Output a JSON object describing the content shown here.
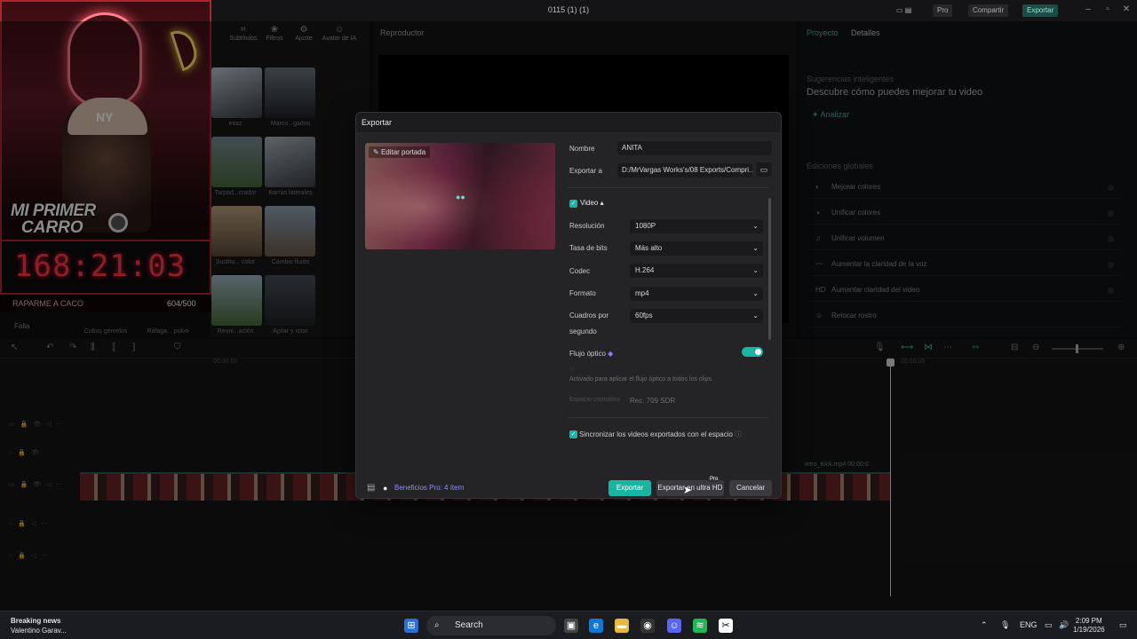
{
  "window": {
    "title": "0115 (1) (1)",
    "pro_label": "Pro",
    "share_label": "Compartir",
    "export_label": "Exportar"
  },
  "media_panel": {
    "tabs": [
      {
        "label": "Subtítulos",
        "icon": "captions-icon"
      },
      {
        "label": "Filtros",
        "icon": "filters-icon"
      },
      {
        "label": "Ajuste",
        "icon": "adjust-icon"
      },
      {
        "label": "Avatar de IA",
        "icon": "ai-avatar-icon"
      }
    ],
    "items": [
      "intaz",
      "Marco...gados",
      "Tarpad...crador",
      "Barras laterales",
      "Sustitu... color",
      "Cambio fluido",
      "Cubos gemelos",
      "Ráfaga... polvo",
      "Reuni...ación",
      "Apilar y rotar"
    ]
  },
  "player": {
    "title": "Reproductor"
  },
  "properties": {
    "tabs": [
      "Proyecto",
      "Detalles"
    ],
    "suggestions_label": "Sugerencias inteligentes",
    "suggestions_text": "Descubre cómo puedes mejorar tu video",
    "analyze_label": "Analizar",
    "global_title": "Ediciones globales",
    "global_items": [
      {
        "label": "Mejorar colores",
        "icon": "color-icon"
      },
      {
        "label": "Unificar colores",
        "icon": "palette-icon"
      },
      {
        "label": "Unificar volumen",
        "icon": "volume-icon"
      },
      {
        "label": "Aumentar la claridad de la voz",
        "icon": "voice-icon"
      },
      {
        "label": "Aumentar claridad del video",
        "icon": "hd-icon"
      },
      {
        "label": "Retocar rostro",
        "icon": "face-icon"
      }
    ]
  },
  "webcam": {
    "title_line1": "MI PRIMER",
    "title_line2": "CARRO",
    "countdown": "168:21:03",
    "goal_label": "RAPARME A CACO",
    "goal_count": "604/500",
    "status": "Falla"
  },
  "timeline": {
    "clip_name": "intro_Kick.mp4",
    "clip_time": "00:00:0",
    "timecodes": [
      "00:00:00",
      "00:00:05"
    ]
  },
  "export_dialog": {
    "title": "Exportar",
    "edit_cover": "Editar portada",
    "name_label": "Nombre",
    "name_value": "ANITA",
    "export_to_label": "Exportar a",
    "export_to_value": "D:/MrVargas Works's/08 Exports/Compri...",
    "video_section": "Video",
    "resolution_label": "Resolución",
    "resolution_value": "1080P",
    "bitrate_label": "Tasa de bits",
    "bitrate_value": "Más alto",
    "codec_label": "Codec",
    "codec_value": "H.264",
    "format_label": "Formato",
    "format_value": "mp4",
    "fps_label": "Cuadros por",
    "fps_label2": "segundo",
    "fps_value": "60fps",
    "optical_flow_label": "Flujo óptico",
    "optical_flow_on": true,
    "optical_flow_help": "Activado para aplicar el flujo óptico a todos los clips.",
    "color_space_label": "Espacio cromático",
    "color_space_value": "Rec. 709 SDR",
    "sync_label": "Sincronizar los videos exportados con el espacio",
    "benefits": "Beneficios Pro: 4 ítem",
    "btn_export": "Exportar",
    "btn_uhd": "Exportar en ultra HD",
    "btn_uhd_badge": "Pro",
    "btn_cancel": "Cancelar"
  },
  "taskbar": {
    "news_title": "Breaking news",
    "news_sub": "Valentino Garav...",
    "search_placeholder": "Search",
    "lang": "ENG",
    "time": "2:09 PM",
    "date": "1/19/2026"
  },
  "colors": {
    "accent": "#19b5a3",
    "danger": "#ff3747",
    "bg": "#0f0f10"
  }
}
